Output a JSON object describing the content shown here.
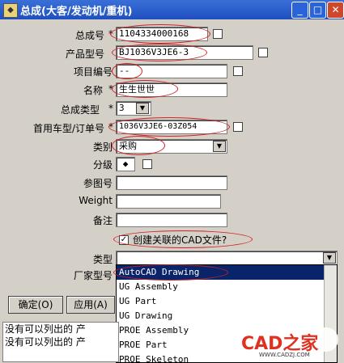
{
  "window": {
    "title": "总成(大客/发动机/重机)",
    "icon": "app-icon"
  },
  "titlebar_buttons": {
    "minimize": "_",
    "maximize": "□",
    "close": "✕"
  },
  "fields": {
    "zongcheng_hao": {
      "label": "总成号",
      "required": "*",
      "value": "1104334000168"
    },
    "chanpin_xinghao": {
      "label": "产品型号",
      "value": "BJ1036V3JE6-3"
    },
    "xiangmu_bianhao": {
      "label": "项目编号",
      "value": "--"
    },
    "mingcheng": {
      "label": "名称",
      "required": "*",
      "value": "生生世世"
    },
    "zongcheng_leixing": {
      "label": "总成类型",
      "required": "*",
      "value": "3"
    },
    "shouyong_chexing": {
      "label": "首用车型/订单号",
      "required": "*",
      "value": "1036V3JE6-03Z054"
    },
    "leibie": {
      "label": "类别",
      "value": "采购"
    },
    "fenji": {
      "label": "分级",
      "value": "◆"
    },
    "cantuhao": {
      "label": "参图号",
      "value": ""
    },
    "weight": {
      "label": "Weight",
      "value": ""
    },
    "beizhu": {
      "label": "备注",
      "value": ""
    },
    "create_cad": {
      "label": "创建关联的CAD文件?",
      "checked": "✓"
    },
    "leixing": {
      "label": "类型",
      "value": ""
    },
    "changjia_xinghao": {
      "label": "厂家型号"
    }
  },
  "type_options": [
    "AutoCAD Drawing",
    "UG Assembly",
    "UG Part",
    "UG Drawing",
    "PROE Assembly",
    "PROE Part",
    "PROE Skeleton"
  ],
  "buttons": {
    "ok": "确定(O)",
    "apply": "应用(A)"
  },
  "messages": [
    "没有可以列出的 产",
    "没有可以列出的 产"
  ],
  "watermark": {
    "brand": "CAD之家",
    "url": "WWW.CADZJ.COM"
  }
}
